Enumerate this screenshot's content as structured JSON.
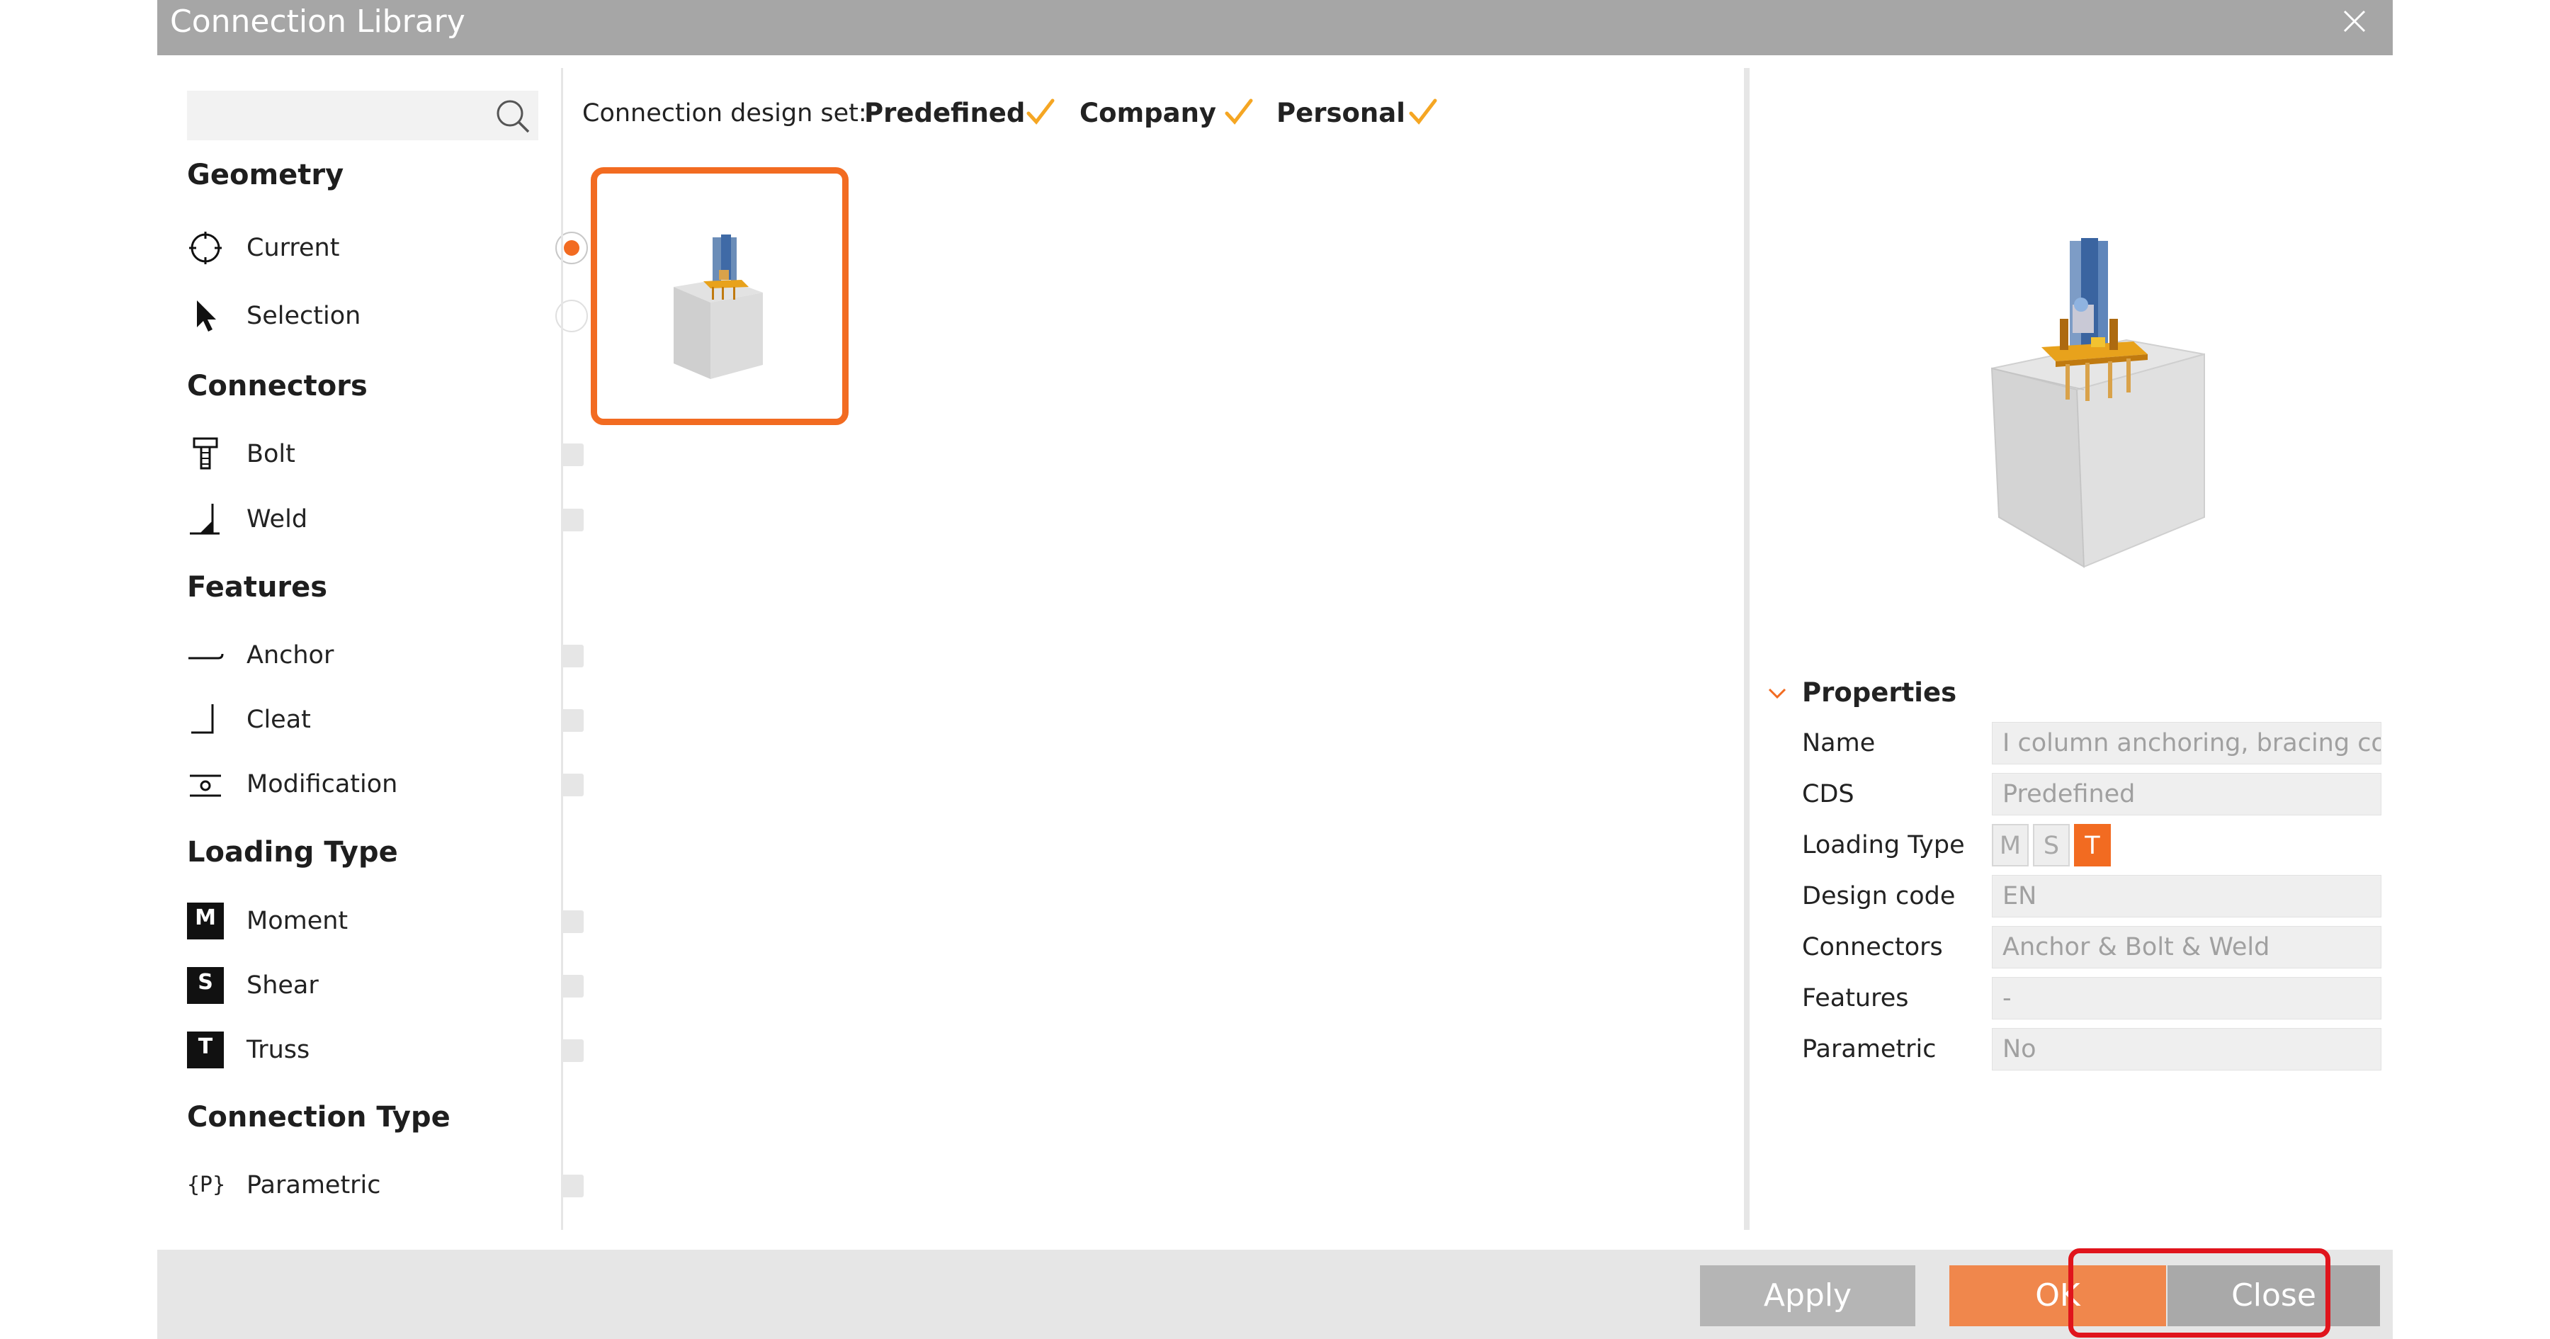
{
  "window": {
    "title": "Connection Library",
    "close_icon": "close-icon"
  },
  "search": {
    "value": "",
    "placeholder": "",
    "icon": "search-icon"
  },
  "filters": {
    "geometry": {
      "title": "Geometry",
      "items": [
        {
          "label": "Current",
          "icon": "target-icon",
          "selected": true
        },
        {
          "label": "Selection",
          "icon": "cursor-arrow-icon",
          "selected": false
        }
      ]
    },
    "connectors": {
      "title": "Connectors",
      "items": [
        {
          "label": "Bolt",
          "icon": "bolt-icon",
          "checked": false
        },
        {
          "label": "Weld",
          "icon": "weld-icon",
          "checked": false
        }
      ]
    },
    "features": {
      "title": "Features",
      "items": [
        {
          "label": "Anchor",
          "icon": "anchor-icon",
          "checked": false
        },
        {
          "label": "Cleat",
          "icon": "cleat-icon",
          "checked": false
        },
        {
          "label": "Modification",
          "icon": "modification-icon",
          "checked": false
        }
      ]
    },
    "loading_type": {
      "title": "Loading Type",
      "items": [
        {
          "label": "Moment",
          "badge": "M",
          "checked": false
        },
        {
          "label": "Shear",
          "badge": "S",
          "checked": false
        },
        {
          "label": "Truss",
          "badge": "T",
          "checked": false
        }
      ]
    },
    "connection_type": {
      "title": "Connection Type",
      "items": [
        {
          "label": "Parametric",
          "icon_text": "{P}",
          "checked": false
        }
      ]
    }
  },
  "design_set": {
    "label": "Connection design set:",
    "options": [
      {
        "label": "Predefined",
        "checked": true
      },
      {
        "label": "Company",
        "checked": true
      },
      {
        "label": "Personal",
        "checked": true
      }
    ]
  },
  "properties": {
    "title": "Properties",
    "name_label": "Name",
    "name_value": "I column anchoring, bracing conn",
    "cds_label": "CDS",
    "cds_value": "Predefined",
    "loading_label": "Loading Type",
    "loading_values": [
      "M",
      "S",
      "T"
    ],
    "loading_active": "T",
    "design_code_label": "Design code",
    "design_code_value": "EN",
    "connectors_label": "Connectors",
    "connectors_value": "Anchor & Bolt & Weld",
    "features_label": "Features",
    "features_value": "-",
    "parametric_label": "Parametric",
    "parametric_value": "No"
  },
  "footer": {
    "apply": "Apply",
    "ok": "OK",
    "close": "Close"
  },
  "colors": {
    "accent": "#f26b21",
    "title_bar": "#a6a6a6",
    "highlight": "#e0141c"
  }
}
